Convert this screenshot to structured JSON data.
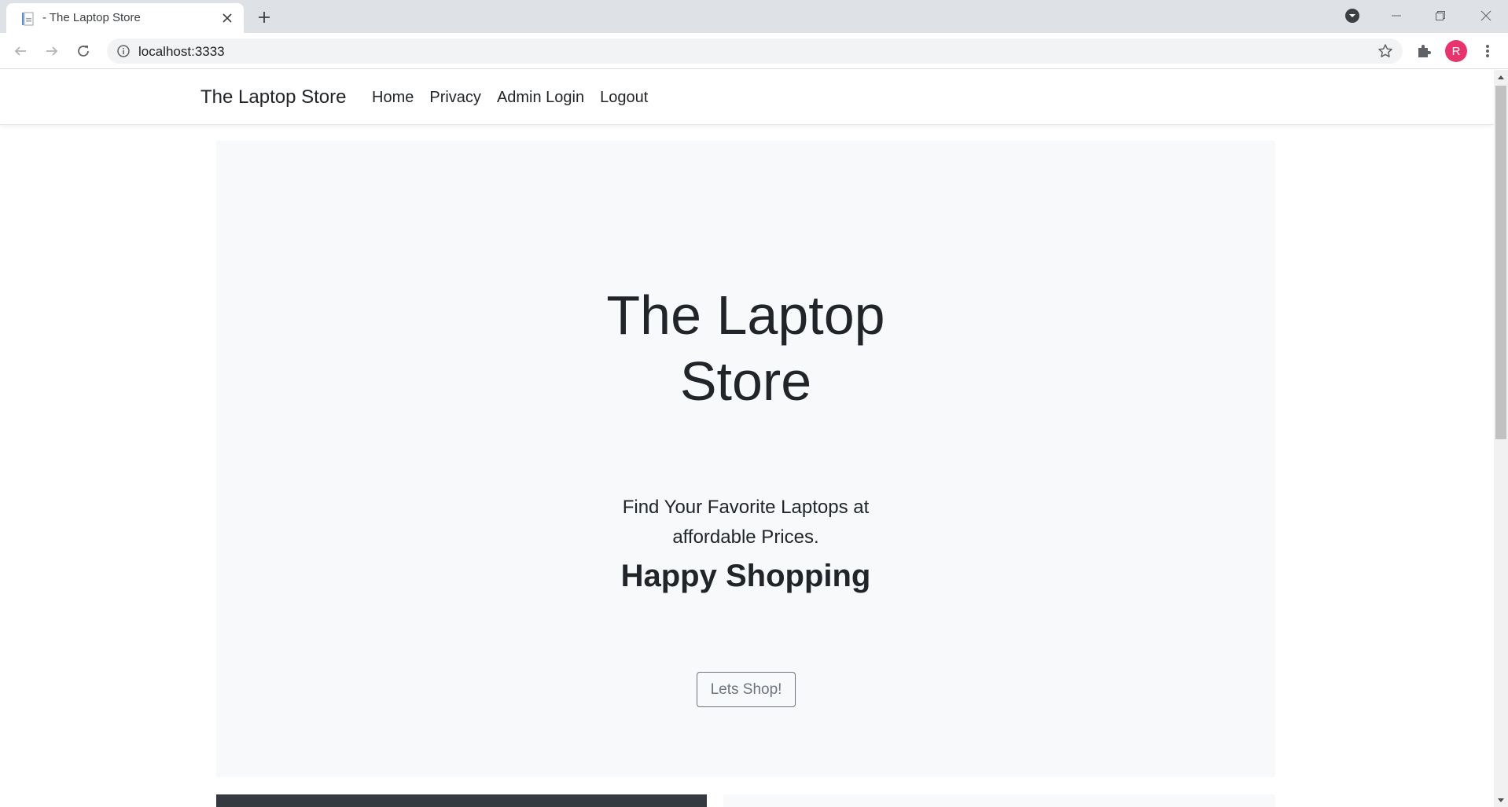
{
  "browser": {
    "tab_title": "- The Laptop Store",
    "url": "localhost:3333",
    "profile_initial": "R"
  },
  "site": {
    "brand": "The Laptop Store",
    "nav": [
      {
        "label": "Home"
      },
      {
        "label": "Privacy"
      },
      {
        "label": "Admin Login"
      },
      {
        "label": "Logout"
      }
    ]
  },
  "hero": {
    "title_line1": "The Laptop",
    "title_line2": "Store",
    "lead_line1": "Find Your Favorite Laptops at",
    "lead_line2": "affordable Prices.",
    "subtitle": "Happy Shopping",
    "button_label": "Lets Shop!"
  },
  "colors": {
    "avatar": "#e8336d",
    "jumbotron_bg": "#f8f9fa",
    "dark_card": "#343a40",
    "button_border": "#6c757d"
  }
}
